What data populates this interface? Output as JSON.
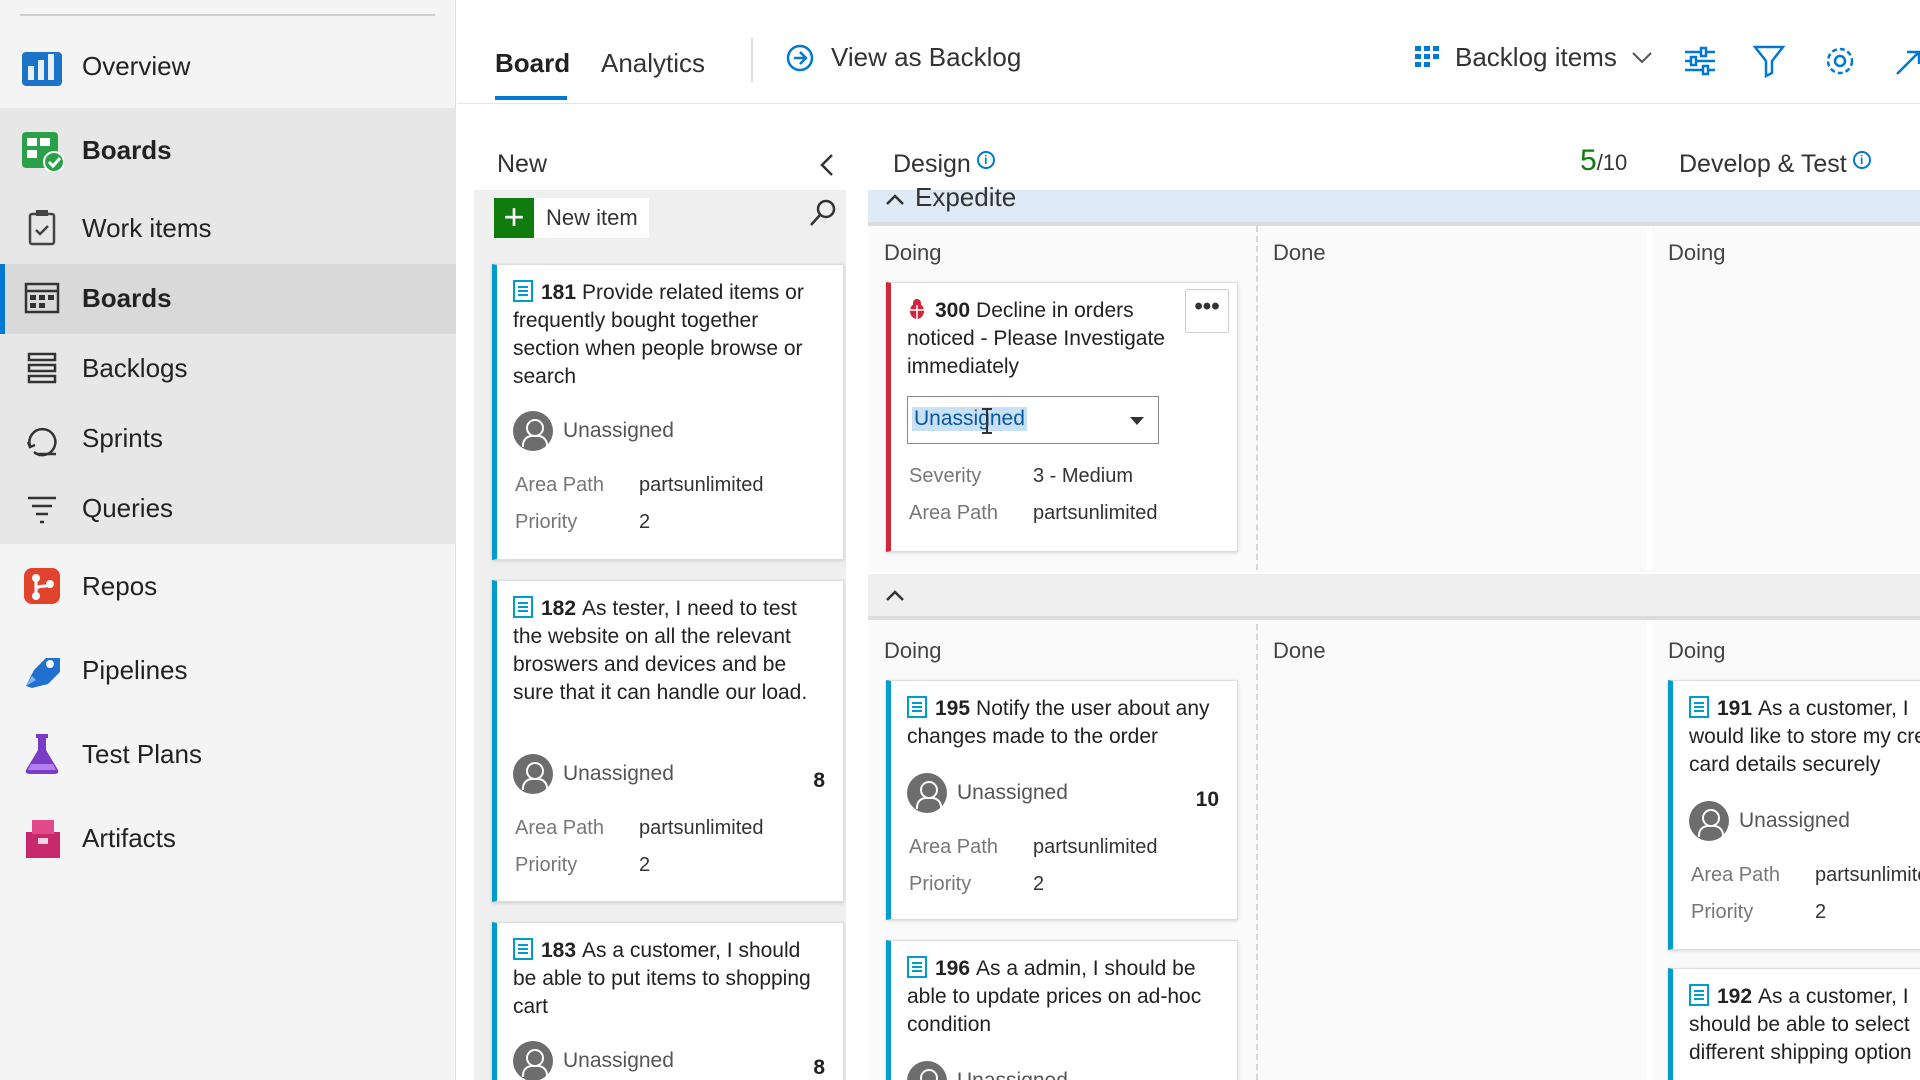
{
  "sidebar": {
    "items": [
      {
        "label": "Overview"
      },
      {
        "label": "Boards"
      },
      {
        "label": "Work items"
      },
      {
        "label": "Boards"
      },
      {
        "label": "Backlogs"
      },
      {
        "label": "Sprints"
      },
      {
        "label": "Queries"
      },
      {
        "label": "Repos"
      },
      {
        "label": "Pipelines"
      },
      {
        "label": "Test Plans"
      },
      {
        "label": "Artifacts"
      }
    ]
  },
  "header": {
    "tabs": [
      {
        "label": "Board"
      },
      {
        "label": "Analytics"
      }
    ],
    "view_as_backlog": "View as Backlog",
    "backlog_items": "Backlog items"
  },
  "columns": {
    "new": {
      "title": "New",
      "new_item": "New item"
    },
    "design": {
      "title": "Design",
      "wip_count": "5",
      "wip_limit": "/10"
    },
    "develop": {
      "title": "Develop & Test"
    }
  },
  "swimlanes": {
    "expedite": "Expedite",
    "doing": "Doing",
    "done": "Done"
  },
  "cards": {
    "c181": {
      "id": "181",
      "title": "Provide related items or frequently bought together section when people browse or search",
      "assignee": "Unassigned",
      "field1": "Area Path",
      "value1": "partsunlimited",
      "field2": "Priority",
      "value2": "2"
    },
    "c182": {
      "id": "182",
      "title": "As tester, I need to test the website on all the relevant broswers and devices and be sure that it can handle our load.",
      "assignee": "Unassigned",
      "effort": "8",
      "field1": "Area Path",
      "value1": "partsunlimited",
      "field2": "Priority",
      "value2": "2"
    },
    "c183": {
      "id": "183",
      "title": "As a customer, I should be able to put items to shopping cart",
      "assignee": "Unassigned",
      "effort": "8"
    },
    "c300": {
      "id": "300",
      "title": "Decline in orders noticed - Please Investigate immediately",
      "assignee_value": "Unassigned",
      "ellipsis": "•••",
      "field1": "Severity",
      "value1": "3 - Medium",
      "field2": "Area Path",
      "value2": "partsunlimited"
    },
    "c195": {
      "id": "195",
      "title": "Notify the user about any changes made to the order",
      "assignee": "Unassigned",
      "effort": "10",
      "field1": "Area Path",
      "value1": "partsunlimited",
      "field2": "Priority",
      "value2": "2"
    },
    "c196": {
      "id": "196",
      "title": "As a admin, I should be able to update prices on ad-hoc condition",
      "assignee": "Unassigned"
    },
    "c191": {
      "id": "191",
      "title": "As a customer, I would like to store my credit card details securely",
      "assignee": "Unassigned",
      "field1": "Area Path",
      "value1": "partsunlimited",
      "field2": "Priority",
      "value2": "2"
    },
    "c192": {
      "id": "192",
      "title": "As a customer, I should be able to select different shipping option"
    }
  },
  "colors": {
    "accent": "#0078d4",
    "story": "#009ccc",
    "bug": "#cc293d",
    "green": "#107c10"
  }
}
